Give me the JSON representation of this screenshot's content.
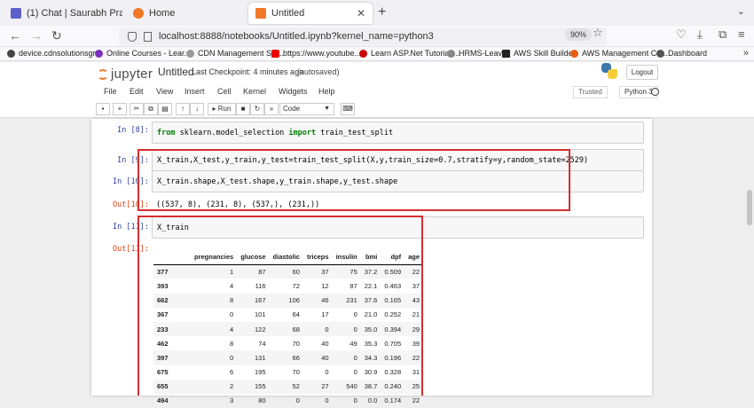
{
  "browser": {
    "tabs": [
      {
        "label": "(1) Chat | Saurabh Prajapati | Mi"
      },
      {
        "label": "Home"
      },
      {
        "label": "Untitled"
      }
    ],
    "url": "localhost:8888/notebooks/Untitled.ipynb?kernel_name=python3",
    "zoom": "90%",
    "bookmarks": [
      {
        "label": "device.cdnsolutionsgr..."
      },
      {
        "label": "Online Courses - Lear..."
      },
      {
        "label": "CDN Management Sys..."
      },
      {
        "label": "https://www.youtube...."
      },
      {
        "label": "Learn ASP.Net Tutorial ..."
      },
      {
        "label": "HRMS-Leave"
      },
      {
        "label": "AWS Skill Builder"
      },
      {
        "label": "AWS Management Co..."
      },
      {
        "label": "Dashboard"
      }
    ]
  },
  "jupyter": {
    "logo_text": "jupyter",
    "notebook_title": "Untitled",
    "checkpoint": "Last Checkpoint: 4 minutes ago",
    "autosave": "(autosaved)",
    "logout_label": "Logout",
    "menu": [
      "File",
      "Edit",
      "View",
      "Insert",
      "Cell",
      "Kernel",
      "Widgets",
      "Help"
    ],
    "trusted_label": "Trusted",
    "kernel_name": "Python 3",
    "run_label": "Run",
    "cell_type": "Code"
  },
  "cells": {
    "c8": {
      "prompt": "In [8]:",
      "code_kw1": "from",
      "code_mid": " sklearn.model_selection ",
      "code_kw2": "import",
      "code_end": " train_test_split"
    },
    "c9": {
      "prompt": "In [9]:",
      "code": "X_train,X_test,y_train,y_test=train_test_split(X,y,train_size=0.7,stratify=y,random_state=2529)"
    },
    "c10": {
      "prompt": "In [10]:",
      "code": "X_train.shape,X_test.shape,y_train.shape,y_test.shape",
      "out_prompt": "Out[10]:",
      "output": "((537, 8), (231, 8), (537,), (231,))"
    },
    "c11": {
      "prompt": "In [11]:",
      "code": "X_train",
      "out_prompt": "Out[11]:"
    }
  },
  "dataframe": {
    "columns": [
      "pregnancies",
      "glucose",
      "diastolic",
      "triceps",
      "insulin",
      "bmi",
      "dpf",
      "age"
    ],
    "rows": [
      {
        "index": "377",
        "values": [
          "1",
          "87",
          "60",
          "37",
          "75",
          "37.2",
          "0.509",
          "22"
        ]
      },
      {
        "index": "393",
        "values": [
          "4",
          "116",
          "72",
          "12",
          "87",
          "22.1",
          "0.463",
          "37"
        ]
      },
      {
        "index": "662",
        "values": [
          "8",
          "167",
          "106",
          "46",
          "231",
          "37.6",
          "0.165",
          "43"
        ]
      },
      {
        "index": "367",
        "values": [
          "0",
          "101",
          "64",
          "17",
          "0",
          "21.0",
          "0.252",
          "21"
        ]
      },
      {
        "index": "233",
        "values": [
          "4",
          "122",
          "68",
          "0",
          "0",
          "35.0",
          "0.394",
          "29"
        ]
      },
      {
        "index": "462",
        "values": [
          "8",
          "74",
          "70",
          "40",
          "49",
          "35.3",
          "0.705",
          "39"
        ]
      },
      {
        "index": "397",
        "values": [
          "0",
          "131",
          "66",
          "40",
          "0",
          "34.3",
          "0.196",
          "22"
        ]
      },
      {
        "index": "675",
        "values": [
          "6",
          "195",
          "70",
          "0",
          "0",
          "30.9",
          "0.328",
          "31"
        ]
      },
      {
        "index": "655",
        "values": [
          "2",
          "155",
          "52",
          "27",
          "540",
          "38.7",
          "0.240",
          "25"
        ]
      },
      {
        "index": "494",
        "values": [
          "3",
          "80",
          "0",
          "0",
          "0",
          "0.0",
          "0.174",
          "22"
        ]
      }
    ]
  },
  "colors": {
    "annotation_box": "#d32f2f",
    "prompt_in": "#303f9f",
    "prompt_out": "#d84315"
  }
}
